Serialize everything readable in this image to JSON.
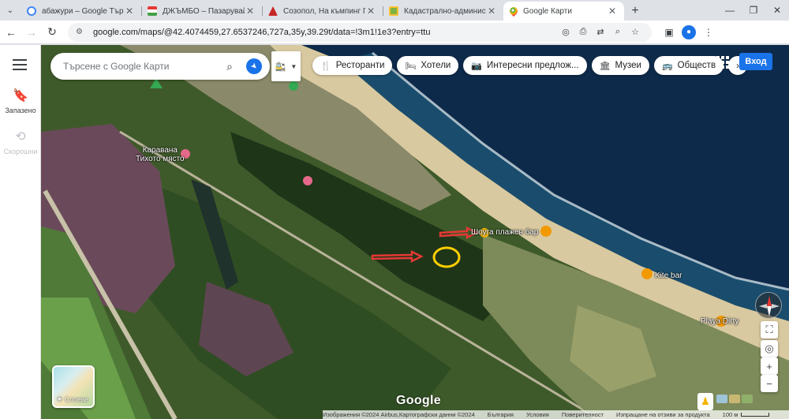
{
  "browser": {
    "tabs": [
      {
        "title": "абажури – Google Търсене",
        "favicon": "google-favicon",
        "color": "#4285f4"
      },
      {
        "title": "ДЖЪМБО – Пазарувай сега он",
        "favicon": "jumbo-favicon",
        "color": "#e53935"
      },
      {
        "title": "Созопол, На къмпинг Градина",
        "favicon": "sozopol-favicon",
        "color": "#c62828"
      },
      {
        "title": "Кадастрално-административни",
        "favicon": "cadastre-favicon",
        "color": "#7cb342"
      },
      {
        "title": "Google Карти",
        "favicon": "google-maps-favicon",
        "color": "#34a853"
      }
    ],
    "active_tab": 4,
    "url": "google.com/maps/@42.4074459,27.6537246,727a,35y,39.29t/data=!3m1!1e3?entry=ttu"
  },
  "maps": {
    "rail": {
      "saved_label": "Запазено",
      "recent_label": "Скорошни"
    },
    "search": {
      "placeholder": "Търсене с Google Карти"
    },
    "chips": [
      {
        "label": "Ресторанти",
        "icon": "fork-knife-icon",
        "glyph": "🍴"
      },
      {
        "label": "Хотели",
        "icon": "bed-icon",
        "glyph": "🛏"
      },
      {
        "label": "Интересни предлож...",
        "icon": "camera-icon",
        "glyph": "📷"
      },
      {
        "label": "Музеи",
        "icon": "museum-icon",
        "glyph": "🏛"
      },
      {
        "label": "Обществ",
        "icon": "transit-icon",
        "glyph": "🚌"
      }
    ],
    "signin_label": "Вход",
    "layers_label": "Слоеве",
    "google_logo": "Google",
    "places": {
      "caravan": "Каравана\nТихото място",
      "beach_bar": "Шоуга плажен бар",
      "kite_bar": "Kite bar",
      "playa": "Playa Dirty"
    },
    "footer": {
      "imagery": "Изображения ©2024 Airbus,Картографски данни ©2024",
      "country": "България",
      "terms": "Условия",
      "privacy": "Поверителност",
      "feedback": "Изпращане на отзиви за продукта",
      "scale": "100 м"
    },
    "accent": "#1a73e8"
  }
}
